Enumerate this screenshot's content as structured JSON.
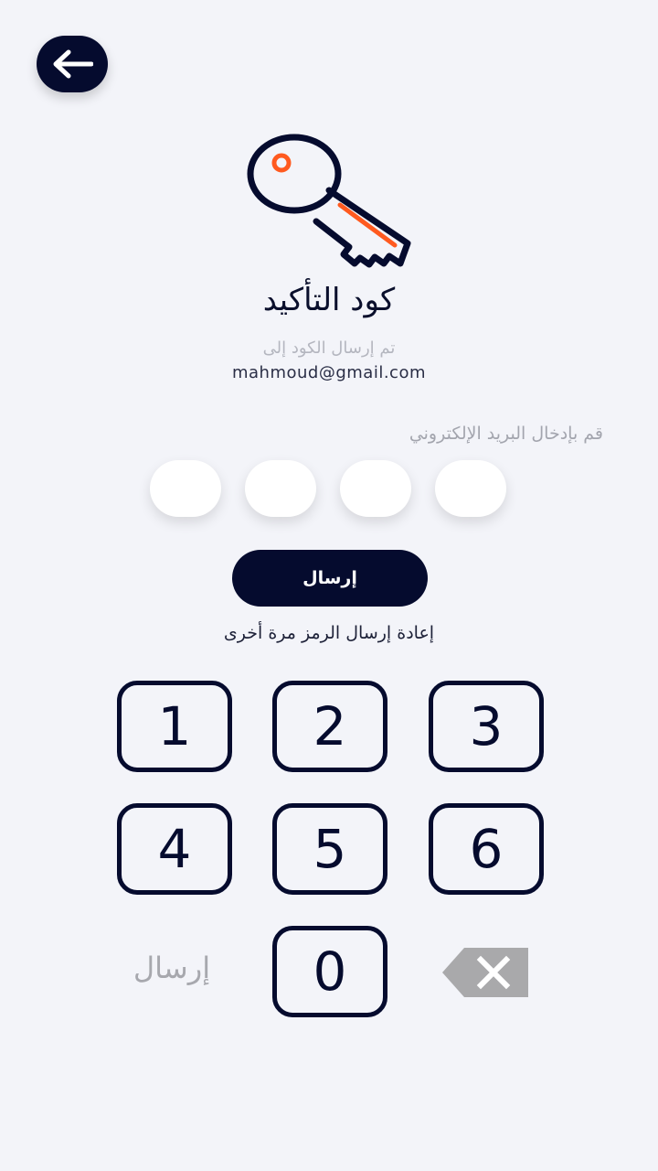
{
  "header": {
    "back_icon": "arrow-left-icon"
  },
  "illustration": {
    "icon": "key-icon",
    "colors": {
      "outline": "#050b2e",
      "accent": "#ff5a1f"
    }
  },
  "page": {
    "title": "كود التأكيد",
    "sent_to_label": "تم إرسال الكود إلى",
    "email": "mahmoud@gmail.com",
    "instruction": "قم بإدخال البريد الإلكتروني"
  },
  "code": {
    "digits": [
      "",
      "",
      "",
      ""
    ]
  },
  "actions": {
    "submit_label": "إرسال",
    "resend_label": "إعادة إرسال الرمز مرة أخرى"
  },
  "keypad": {
    "keys": [
      "1",
      "2",
      "3",
      "4",
      "5",
      "6",
      "0"
    ],
    "send_label": "إرسال",
    "backspace_icon": "backspace-x-icon"
  },
  "colors": {
    "primary": "#050b2e",
    "background": "#f3f4f9",
    "muted": "#a7a8ae"
  }
}
